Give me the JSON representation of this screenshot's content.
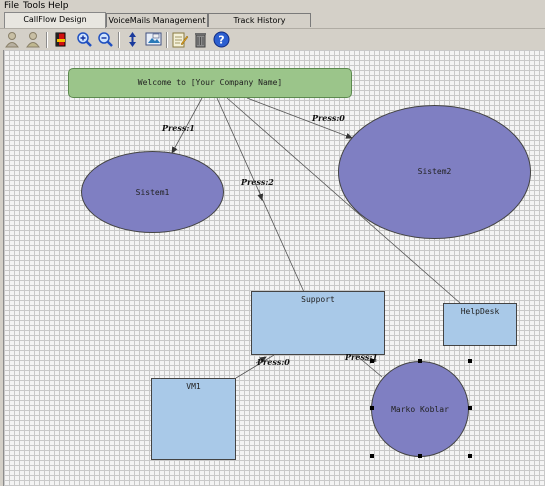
{
  "menu": [
    "File",
    "Tools",
    "Help"
  ],
  "tabs": [
    {
      "label": "CallFlow Design",
      "active": true
    },
    {
      "label": "VoiceMails Management",
      "active": false
    },
    {
      "label": "Track History",
      "active": false
    }
  ],
  "toolbar": [
    "user-add-icon",
    "user-remove-icon",
    "book-icon",
    "zoom-in-icon",
    "zoom-out-icon",
    "up-down-arrows-icon",
    "image-export-icon",
    "edit-note-icon",
    "trash-icon",
    "help-icon"
  ],
  "colors": {
    "welcome_fill": "#9bc58a",
    "ellipse_fill": "#7f7fc2",
    "box_fill": "#a9c9e8",
    "grid": "#c9c9c9"
  },
  "nodes": {
    "welcome": "Welcome to [Your Company Name]",
    "sistem1": "Sistem1",
    "sistem2": "Sistem2",
    "support": "Support",
    "helpdesk": "HelpDesk",
    "vm1": "VM1",
    "marko": "Marko Koblar"
  },
  "edges": {
    "press1_sistem1": "Press:1",
    "press0_sistem2": "Press:0",
    "press2_support": "Press:2",
    "press0_vm1": "Press:0",
    "press1_marko": "Press:1"
  }
}
